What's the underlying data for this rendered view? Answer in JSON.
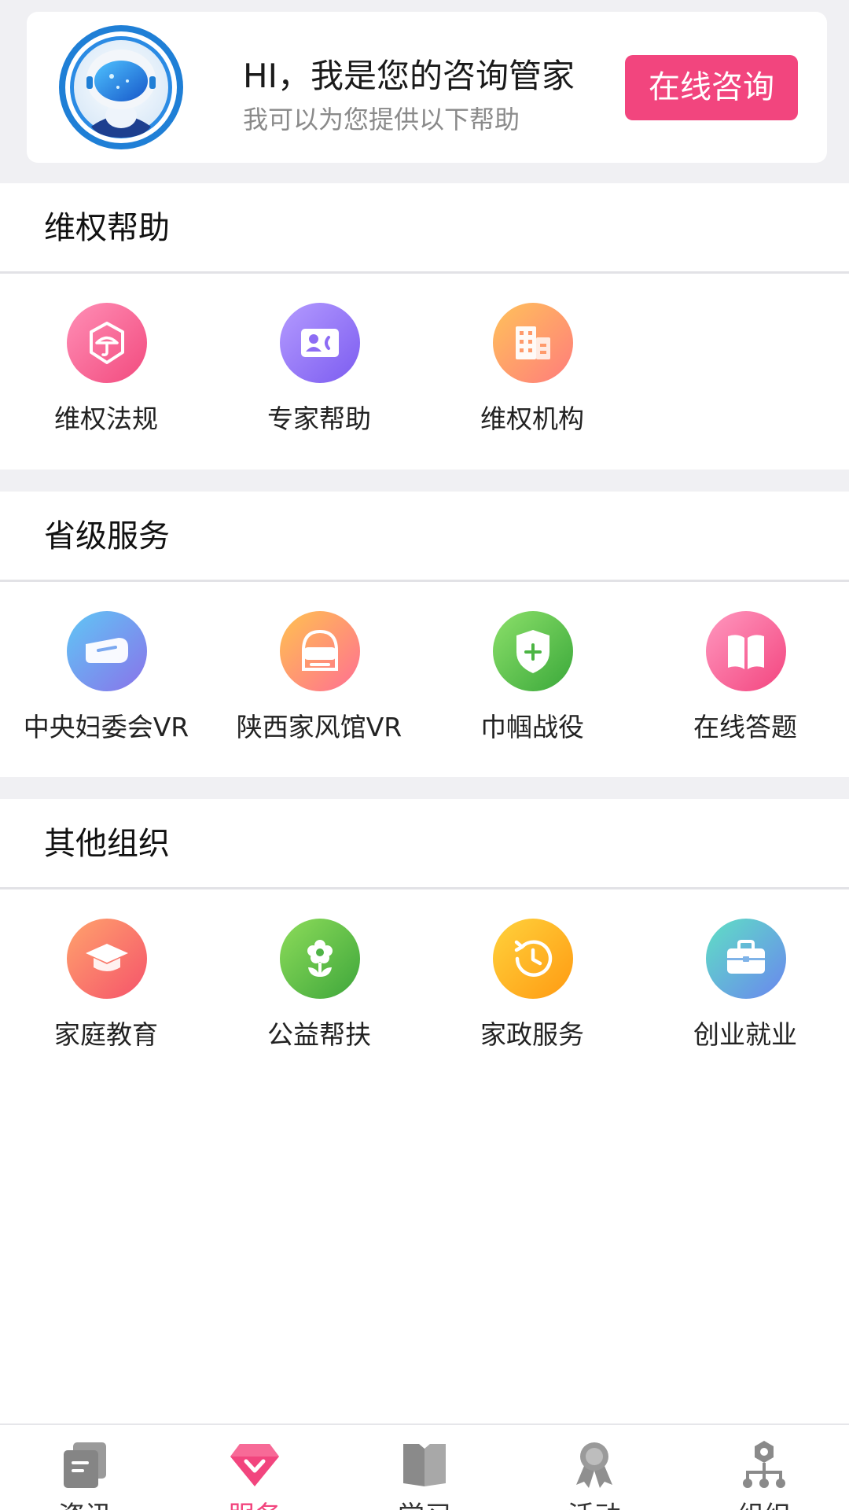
{
  "consult": {
    "title": "HI，我是您的咨询管家",
    "subtitle": "我可以为您提供以下帮助",
    "button": "在线咨询"
  },
  "sections": [
    {
      "title": "维权帮助",
      "items": [
        {
          "label": "维权法规",
          "icon": "umbrella-shield-icon"
        },
        {
          "label": "专家帮助",
          "icon": "contact-card-icon"
        },
        {
          "label": "维权机构",
          "icon": "building-icon"
        }
      ]
    },
    {
      "title": "省级服务",
      "items": [
        {
          "label": "中央妇委会VR",
          "icon": "vr-headset-icon"
        },
        {
          "label": "陕西家风馆VR",
          "icon": "vr-helmet-icon"
        },
        {
          "label": "巾帼战役",
          "icon": "medical-shield-icon"
        },
        {
          "label": "在线答题",
          "icon": "book-icon"
        }
      ]
    },
    {
      "title": "其他组织",
      "items": [
        {
          "label": "家庭教育",
          "icon": "graduation-cap-icon"
        },
        {
          "label": "公益帮扶",
          "icon": "flower-icon"
        },
        {
          "label": "家政服务",
          "icon": "clock-history-icon"
        },
        {
          "label": "创业就业",
          "icon": "briefcase-icon"
        }
      ]
    }
  ],
  "tabs": [
    {
      "label": "资讯",
      "icon": "news-icon",
      "active": false
    },
    {
      "label": "服务",
      "icon": "diamond-heart-icon",
      "active": true
    },
    {
      "label": "学习",
      "icon": "book-stack-icon",
      "active": false
    },
    {
      "label": "活动",
      "icon": "award-ribbon-icon",
      "active": false
    },
    {
      "label": "组织",
      "icon": "org-tree-icon",
      "active": false
    }
  ],
  "colors": {
    "accent": "#f2457e",
    "background": "#f0f0f3"
  }
}
